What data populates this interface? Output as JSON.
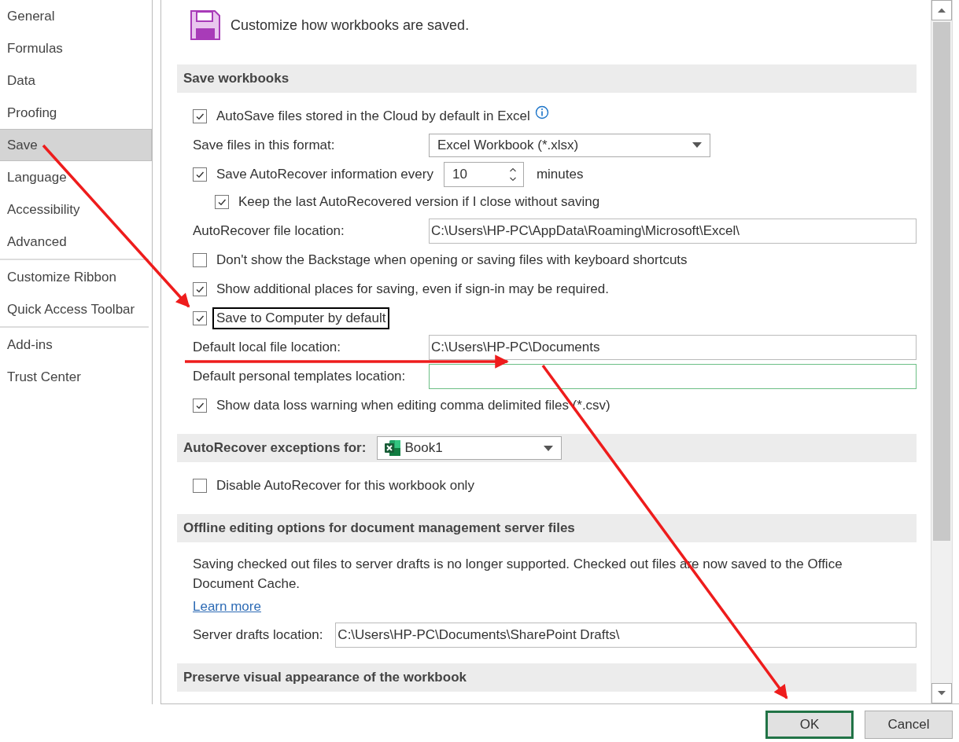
{
  "sidebar": {
    "groups": [
      [
        {
          "label": "General",
          "selected": false
        },
        {
          "label": "Formulas",
          "selected": false
        },
        {
          "label": "Data",
          "selected": false
        },
        {
          "label": "Proofing",
          "selected": false
        },
        {
          "label": "Save",
          "selected": true
        },
        {
          "label": "Language",
          "selected": false
        },
        {
          "label": "Accessibility",
          "selected": false
        },
        {
          "label": "Advanced",
          "selected": false
        }
      ],
      [
        {
          "label": "Customize Ribbon",
          "selected": false
        },
        {
          "label": "Quick Access Toolbar",
          "selected": false
        }
      ],
      [
        {
          "label": "Add-ins",
          "selected": false
        },
        {
          "label": "Trust Center",
          "selected": false
        }
      ]
    ]
  },
  "header": {
    "title": "Customize how workbooks are saved."
  },
  "sections": [
    {
      "title": "Save workbooks",
      "rows": [
        {
          "kind": "checkbox",
          "label": "AutoSave files stored in the Cloud by default in Excel",
          "checked": true,
          "info": true
        },
        {
          "kind": "select",
          "label": "Save files in this format:",
          "value": "Excel Workbook (*.xlsx)"
        },
        {
          "kind": "spin",
          "label": "Save AutoRecover information every",
          "checked": true,
          "value": "10",
          "unit": "minutes",
          "children": [
            {
              "kind": "checkbox",
              "label": "Keep the last AutoRecovered version if I close without saving",
              "checked": true
            }
          ]
        },
        {
          "kind": "path",
          "label": "AutoRecover file location:",
          "value": "C:\\Users\\HP-PC\\AppData\\Roaming\\Microsoft\\Excel\\"
        },
        {
          "kind": "checkbox",
          "label": "Don't show the Backstage when opening or saving files with keyboard shortcuts",
          "checked": false
        },
        {
          "kind": "checkbox",
          "label": "Show additional places for saving, even if sign-in may be required.",
          "checked": true
        },
        {
          "kind": "checkbox",
          "label": "Save to Computer by default",
          "checked": true,
          "highlighted": true
        },
        {
          "kind": "path",
          "label": "Default local file location:",
          "value": "C:\\Users\\HP-PC\\Documents"
        },
        {
          "kind": "path",
          "label": "Default personal templates location:",
          "focused": true
        },
        {
          "kind": "checkbox",
          "label": "Show data loss warning when editing comma delimited files (*.csv)",
          "checked": true
        }
      ]
    },
    {
      "title": "AutoRecover exceptions for:",
      "dropdown": {
        "value": "Book1"
      },
      "rows": [
        {
          "kind": "checkbox",
          "label": "Disable AutoRecover for this workbook only",
          "checked": false
        }
      ]
    },
    {
      "title": "Offline editing options for document management server files",
      "rows": [
        {
          "kind": "paragraph",
          "text": "Saving checked out files to server drafts is no longer supported. Checked out files are now saved to the Office Document Cache."
        },
        {
          "kind": "link",
          "text": "Learn more"
        },
        {
          "kind": "path",
          "label": "Server drafts location:",
          "value": "C:\\Users\\HP-PC\\Documents\\SharePoint Drafts\\",
          "compact": true
        }
      ]
    },
    {
      "title": "Preserve visual appearance of the workbook"
    }
  ],
  "buttons": [
    {
      "label": "OK",
      "default": true
    },
    {
      "label": "Cancel",
      "default": false
    }
  ]
}
